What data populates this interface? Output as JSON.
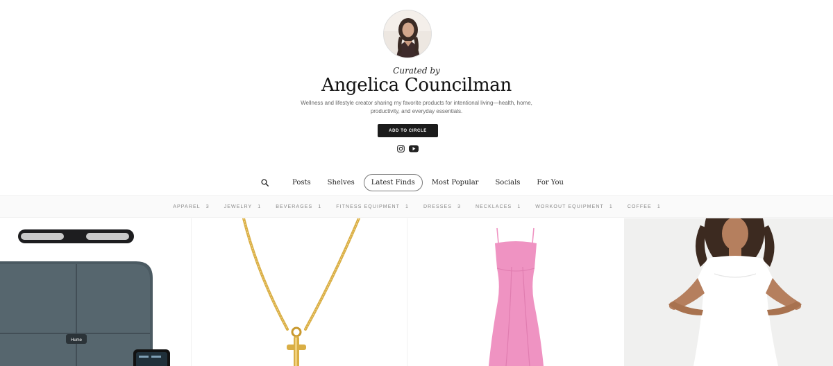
{
  "profile": {
    "curated_by": "Curated by",
    "name": "Angelica Councilman",
    "bio": "Wellness and lifestyle creator sharing my favorite products for intentional living—health, home, productivity, and everyday essentials.",
    "add_button": "ADD TO CIRCLE",
    "socials": [
      "instagram-icon",
      "youtube-icon"
    ]
  },
  "tabs": {
    "search_icon": "search-icon",
    "items": [
      "Posts",
      "Shelves",
      "Latest Finds",
      "Most Popular",
      "Socials",
      "For You"
    ],
    "active": "Latest Finds"
  },
  "categories": [
    {
      "label": "APPAREL",
      "count": "3"
    },
    {
      "label": "JEWELRY",
      "count": "1"
    },
    {
      "label": "BEVERAGES",
      "count": "1"
    },
    {
      "label": "FITNESS EQUIPMENT",
      "count": "1"
    },
    {
      "label": "DRESSES",
      "count": "3"
    },
    {
      "label": "NECKLACES",
      "count": "1"
    },
    {
      "label": "WORKOUT EQUIPMENT",
      "count": "1"
    },
    {
      "label": "COFFEE",
      "count": "1"
    }
  ],
  "products": {
    "scale_logo": "Hume"
  },
  "colors": {
    "button_bg": "#1b1b1b",
    "dress_pink": "#ef93c2",
    "necklace_gold": "#d9ae45",
    "scale_slate": "#4b5a62"
  }
}
